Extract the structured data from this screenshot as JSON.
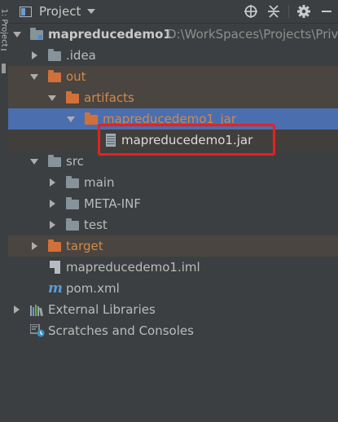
{
  "side_strip": {
    "label": "1: Project"
  },
  "header": {
    "title": "Project"
  },
  "tree": {
    "root": {
      "name": "mapreducedemo1",
      "path": "D:\\WorkSpaces\\Projects\\Priv"
    },
    "idea": ".idea",
    "out": "out",
    "artifacts": "artifacts",
    "artifact_dir": "mapreducedemo1_jar",
    "jar_file": "mapreducedemo1.jar",
    "src": "src",
    "main": "main",
    "meta_inf": "META-INF",
    "test": "test",
    "target": "target",
    "iml": "mapreducedemo1.iml",
    "pom": "pom.xml",
    "pom_glyph": "m",
    "external_libraries": "External Libraries",
    "scratches": "Scratches and Consoles"
  },
  "icons": [
    "project-view-icon",
    "locate-icon",
    "collapse-all-icon",
    "gear-icon",
    "minimize-icon",
    "folder-icon",
    "module-folder-icon",
    "jar-icon",
    "iml-file-icon",
    "maven-icon",
    "libraries-icon",
    "scratches-icon"
  ],
  "colors": {
    "background": "#3c3f41",
    "selection": "#4b6eaf",
    "excluded_folder": "#d2703a",
    "highlight_box": "#e8201f"
  }
}
